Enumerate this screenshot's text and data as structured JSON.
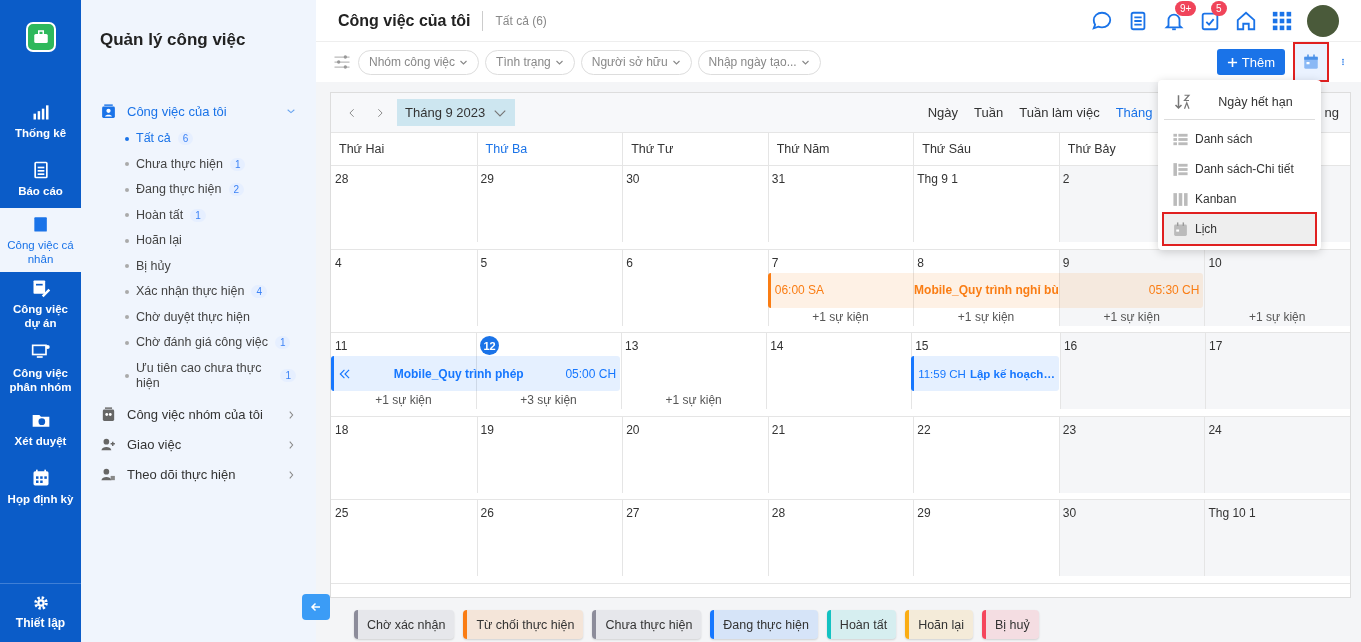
{
  "rail": {
    "items": [
      {
        "label": "Thống kê",
        "selected": false
      },
      {
        "label": "Báo cáo",
        "selected": false
      },
      {
        "label": "Công việc cá nhân",
        "selected": true
      },
      {
        "label": "Công việc dự án",
        "selected": false
      },
      {
        "label": "Công việc phân nhóm",
        "selected": false
      },
      {
        "label": "Xét duyệt",
        "selected": false
      },
      {
        "label": "Họp định kỳ",
        "selected": false
      }
    ],
    "footer": {
      "label": "Thiết lập"
    }
  },
  "sidebar": {
    "title": "Quản lý công việc",
    "groups": [
      {
        "label": "Công việc của tôi",
        "expanded": true,
        "children": [
          {
            "label": "Tất cả",
            "count": "6",
            "selected": true
          },
          {
            "label": "Chưa thực hiện",
            "count": "1",
            "selected": false
          },
          {
            "label": "Đang thực hiện",
            "count": "2",
            "selected": false
          },
          {
            "label": "Hoàn tất",
            "count": "1",
            "selected": false
          },
          {
            "label": "Hoãn lại",
            "selected": false
          },
          {
            "label": "Bị hủy",
            "selected": false
          },
          {
            "label": "Xác nhận thực hiện",
            "count": "4",
            "selected": false
          },
          {
            "label": "Chờ duyệt thực hiện",
            "selected": false
          },
          {
            "label": "Chờ đánh giá công việc",
            "count": "1",
            "selected": false
          },
          {
            "label": "Ưu tiên cao chưa thực hiện",
            "count": "1",
            "selected": false
          }
        ]
      },
      {
        "label": "Công việc nhóm của tôi",
        "expanded": false
      },
      {
        "label": "Giao việc",
        "expanded": false
      },
      {
        "label": "Theo dõi thực hiện",
        "expanded": false
      }
    ]
  },
  "header": {
    "title": "Công việc của tôi",
    "subtitle": "Tất cả (6)",
    "notifications_badge": "9+",
    "tasks_badge": "5"
  },
  "filters": [
    "Nhóm công việc",
    "Tình trạng",
    "Người sở hữu",
    "Nhập ngày tạo..."
  ],
  "add_button": "Thêm",
  "view_menu": {
    "sort": "Ngày hết hạn",
    "items": [
      {
        "label": "Danh sách",
        "selected": false
      },
      {
        "label": "Danh sách-Chi tiết",
        "selected": false
      },
      {
        "label": "Kanban",
        "selected": false
      },
      {
        "label": "Lịch",
        "selected": true
      }
    ]
  },
  "calendar": {
    "month": "Tháng 9 2023",
    "views": [
      {
        "label": "Ngày",
        "selected": false
      },
      {
        "label": "Tuần",
        "selected": false
      },
      {
        "label": "Tuần làm việc",
        "selected": false
      },
      {
        "label": "Tháng",
        "selected": true
      },
      {
        "label": "ng",
        "selected": false
      }
    ],
    "weekdays": [
      {
        "label": "Thứ Hai",
        "today": false
      },
      {
        "label": "Thứ Ba",
        "today": true
      },
      {
        "label": "Thứ Tư",
        "today": false
      },
      {
        "label": "Thứ Năm",
        "today": false
      },
      {
        "label": "Thứ Sáu",
        "today": false
      },
      {
        "label": "Thứ Bảy",
        "today": false
      }
    ],
    "weeks": [
      {
        "days": [
          {
            "number": "28"
          },
          {
            "number": "29"
          },
          {
            "number": "30"
          },
          {
            "number": "31"
          },
          {
            "number": "Thg 9 1"
          },
          {
            "number": "2"
          }
        ]
      },
      {
        "days": [
          {
            "number": "4"
          },
          {
            "number": "5"
          },
          {
            "number": "6"
          },
          {
            "number": "7",
            "more": "+1 sự kiện",
            "event": {
              "color": "#fa7d14",
              "start": "06:00 SA",
              "title": "Mobile_Quy trình nghỉ bù",
              "end": "05:30 CH"
            }
          },
          {
            "number": "8",
            "more": "+1 sự kiện",
            "continues": true
          },
          {
            "number": "9",
            "more": "+1 sự kiện",
            "continues": true
          },
          {
            "number": "10",
            "more": "+1 sự kiện"
          }
        ]
      },
      {
        "days": [
          {
            "number": "11",
            "more": "+1 sự kiện",
            "event": {
              "color": "#1677ff",
              "from_before": true,
              "title": "Mobile_Quy trình phép",
              "end": "05:00 CH"
            }
          },
          {
            "number": "12",
            "today": true,
            "more": "+3 sự kiện",
            "continues": true
          },
          {
            "number": "13",
            "more": "+1 sự kiện"
          },
          {
            "number": "14"
          },
          {
            "number": "15",
            "event": {
              "color": "#1677ff",
              "start": "11:59 CH",
              "title": "Lập kế hoạch…"
            }
          },
          {
            "number": "16"
          },
          {
            "number": "17"
          }
        ]
      },
      {
        "days": [
          {
            "number": "18"
          },
          {
            "number": "19"
          },
          {
            "number": "20"
          },
          {
            "number": "21"
          },
          {
            "number": "22"
          },
          {
            "number": "23"
          },
          {
            "number": "24"
          }
        ]
      },
      {
        "days": [
          {
            "number": "25"
          },
          {
            "number": "26"
          },
          {
            "number": "27"
          },
          {
            "number": "28"
          },
          {
            "number": "29"
          },
          {
            "number": "30"
          },
          {
            "number": "Thg 10 1"
          }
        ]
      }
    ]
  },
  "legend": [
    {
      "label": "Chờ xác nhận",
      "color": "#8c8c9a"
    },
    {
      "label": "Từ chối thực hiện",
      "color": "#fa7d14"
    },
    {
      "label": "Chưa thực hiện",
      "color": "#8c8c9a"
    },
    {
      "label": "Đang thực hiện",
      "color": "#1677ff"
    },
    {
      "label": "Hoàn tất",
      "color": "#13c2c2"
    },
    {
      "label": "Hoãn lại",
      "color": "#faad14"
    },
    {
      "label": "Bị huỷ",
      "color": "#f5455c"
    }
  ]
}
